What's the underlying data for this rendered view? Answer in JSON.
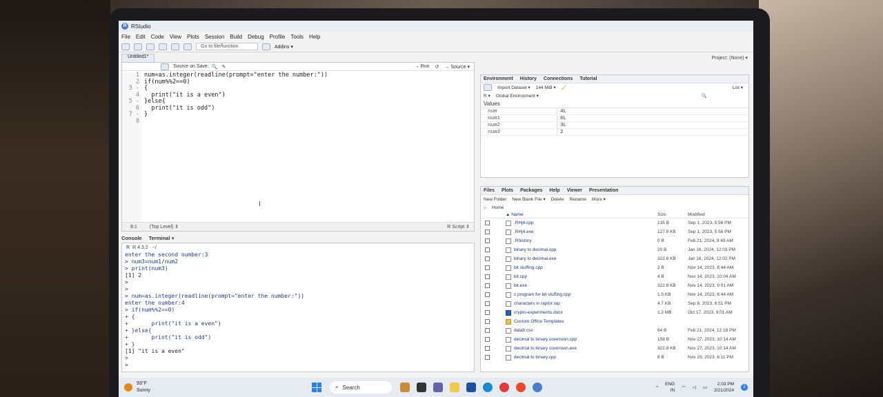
{
  "window": {
    "title": "RStudio",
    "controls": [
      "–",
      "▢",
      "✕"
    ]
  },
  "menu": [
    "File",
    "Edit",
    "Code",
    "View",
    "Plots",
    "Session",
    "Build",
    "Debug",
    "Profile",
    "Tools",
    "Help"
  ],
  "toolbar": {
    "goto_placeholder": "Go to file/function",
    "addins_label": "Addins ▾",
    "project_label": "Project: (None) ▾"
  },
  "editor": {
    "tab_label": "Untitled1*",
    "source_on_save": "Source on Save",
    "run_label": "→ Run",
    "source_label": "→ Source ▾",
    "line_numbers": [
      "1",
      "2",
      "3 -",
      "4",
      "5 -",
      "6",
      "7 -",
      "8"
    ],
    "lines": [
      "num=as.integer(readline(prompt=\"enter the number:\"))",
      "if(num%%2==0)",
      "{",
      "  print(\"it is a even\")",
      "}else{",
      "  print(\"it is odd\")",
      "}",
      ""
    ],
    "status_position": "8:1",
    "status_scope": "(Top Level) ⇕",
    "status_type": "R Script ⇕"
  },
  "console": {
    "tabs": [
      "Console",
      "Terminal ×"
    ],
    "version": "R 4.3.2 · ~/",
    "lines": [
      {
        "kind": "in",
        "text": "enter the second number:3"
      },
      {
        "kind": "in",
        "text": "> num3=num1/num2"
      },
      {
        "kind": "in",
        "text": "> print(num3)"
      },
      {
        "kind": "out",
        "text": "[1] 2"
      },
      {
        "kind": "in",
        "text": ">"
      },
      {
        "kind": "in",
        "text": ">"
      },
      {
        "kind": "in",
        "text": "> num=as.integer(readline(prompt=\"enter the number:\"))"
      },
      {
        "kind": "in",
        "text": "enter the number:4"
      },
      {
        "kind": "in",
        "text": "> if(num%%2==0)"
      },
      {
        "kind": "in",
        "text": "+ {"
      },
      {
        "kind": "in",
        "text": "+       print(\"it is a even\")"
      },
      {
        "kind": "in",
        "text": "+ }else{"
      },
      {
        "kind": "in",
        "text": "+       print(\"it is odd\")"
      },
      {
        "kind": "in",
        "text": "+ }"
      },
      {
        "kind": "out",
        "text": "[1] \"it is a even\""
      },
      {
        "kind": "in",
        "text": ">"
      },
      {
        "kind": "in",
        "text": ">"
      }
    ]
  },
  "environment": {
    "tabs": [
      "Environment",
      "History",
      "Connections",
      "Tutorial"
    ],
    "import_label": "Import Dataset ▾",
    "memory_label": "144 MiB ▾",
    "lang_label": "R ▾",
    "scope_label": "Global Environment ▾",
    "list_label": "List ▾",
    "section": "Values",
    "rows": [
      {
        "name": "num",
        "value": "4L"
      },
      {
        "name": "num1",
        "value": "6L"
      },
      {
        "name": "num2",
        "value": "3L"
      },
      {
        "name": "num3",
        "value": "2"
      }
    ]
  },
  "files": {
    "tabs": [
      "Files",
      "Plots",
      "Packages",
      "Help",
      "Viewer",
      "Presentation"
    ],
    "new_folder": "New Folder",
    "new_blank": "New Blank File ▾",
    "delete": "Delete",
    "rename": "Rename",
    "more": "More ▾",
    "home": "Home",
    "col_name": "▲ Name",
    "col_size": "Size",
    "col_modified": "Modified",
    "rows": [
      {
        "icon": "code",
        "name": ".RHj4.cpp",
        "size": "135 B",
        "modified": "Sep 1, 2023, 5:56 PM"
      },
      {
        "icon": "file",
        "name": ".RHj4.exe",
        "size": "127.9 KB",
        "modified": "Sep 1, 2023, 5:56 PM"
      },
      {
        "icon": "file",
        "name": ".Rhistory",
        "size": "0 B",
        "modified": "Feb 21, 2024, 9:49 AM"
      },
      {
        "icon": "code",
        "name": "binary to decimal.cpp",
        "size": "20 B",
        "modified": "Jan 16, 2024, 12:03 PM"
      },
      {
        "icon": "file",
        "name": "binary to decimal.exe",
        "size": "322.6 KB",
        "modified": "Jan 16, 2024, 12:02 PM"
      },
      {
        "icon": "code",
        "name": "bit stuffing.cpp",
        "size": "2 B",
        "modified": "Nov 14, 2023, 8:44 AM"
      },
      {
        "icon": "code",
        "name": "bit.cpp",
        "size": "4 B",
        "modified": "Nov 14, 2023, 10:04 AM"
      },
      {
        "icon": "file",
        "name": "bit.exe",
        "size": "322.8 KB",
        "modified": "Nov 14, 2023, 9:01 AM"
      },
      {
        "icon": "code",
        "name": "c program for bit stuffing.cpp",
        "size": "1.5 KB",
        "modified": "Nov 14, 2023, 8:44 AM"
      },
      {
        "icon": "file",
        "name": "characters in raptor.rap",
        "size": "4.7 KB",
        "modified": "Sep 8, 2023, 6:51 PM"
      },
      {
        "icon": "word",
        "name": "crypto-experiments.docx",
        "size": "1.2 MB",
        "modified": "Oct 17, 2023, 9:01 AM"
      },
      {
        "icon": "folder",
        "name": "Custom Office Templates",
        "size": "",
        "modified": ""
      },
      {
        "icon": "file",
        "name": "datafr.csv",
        "size": "84 B",
        "modified": "Feb 21, 2024, 12:18 PM"
      },
      {
        "icon": "code",
        "name": "decimal to binary coversion.cpp",
        "size": "158 B",
        "modified": "Nov 27, 2023, 10:14 AM"
      },
      {
        "icon": "code",
        "name": "decimal to binary coversion.exe",
        "size": "322.8 KB",
        "modified": "Nov 27, 2023, 10:14 AM"
      },
      {
        "icon": "code",
        "name": "decimal to binary.cpp",
        "size": "6 B",
        "modified": "Nov 29, 2023, 6:11 PM"
      }
    ]
  },
  "taskbar": {
    "temperature": "93°F",
    "weather": "Sunny",
    "search_label": "Search",
    "lang_top": "ENG",
    "lang_bottom": "IN",
    "time": "2:03 PM",
    "date": "2/21/2024"
  }
}
